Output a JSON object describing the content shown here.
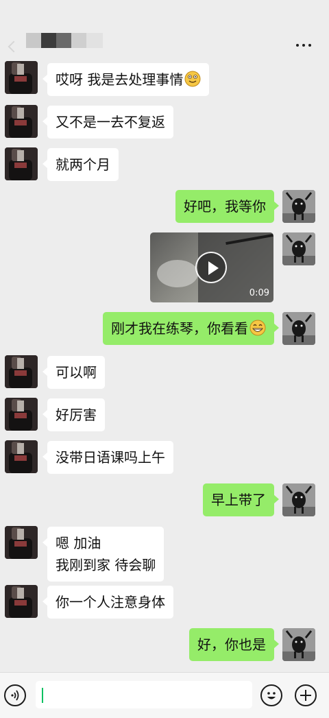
{
  "header": {
    "back_icon": "chevron-left-icon",
    "contact_name_obscured": true,
    "more_icon": "more-dots-icon"
  },
  "colors": {
    "background": "#ededed",
    "sent_bubble": "#95ec69",
    "received_bubble": "#ffffff",
    "caret": "#07c160"
  },
  "messages": [
    {
      "side": "left",
      "text": "哎呀 我是去处理事情",
      "emoji": "grimace-emoji-icon"
    },
    {
      "side": "left",
      "text": "又不是一去不复返"
    },
    {
      "side": "left",
      "text": "就两个月"
    },
    {
      "side": "right",
      "text": "好吧，我等你"
    },
    {
      "side": "right",
      "type": "video",
      "duration": "0:09"
    },
    {
      "side": "right",
      "text": "刚才我在练琴，你看看",
      "emoji": "grin-emoji-icon"
    },
    {
      "side": "left",
      "text": "可以啊"
    },
    {
      "side": "left",
      "text": "好厉害"
    },
    {
      "side": "left",
      "text": "没带日语课吗上午"
    },
    {
      "side": "right",
      "text": "早上带了"
    },
    {
      "side": "left",
      "lines": [
        "嗯 加油",
        "我刚到家 待会聊"
      ]
    },
    {
      "side": "left",
      "text": "你一个人注意身体"
    },
    {
      "side": "right",
      "text": "好，你也是"
    }
  ],
  "input_bar": {
    "voice_icon": "voice-icon",
    "emoji_icon": "emoji-icon",
    "plus_icon": "plus-icon",
    "value": ""
  }
}
